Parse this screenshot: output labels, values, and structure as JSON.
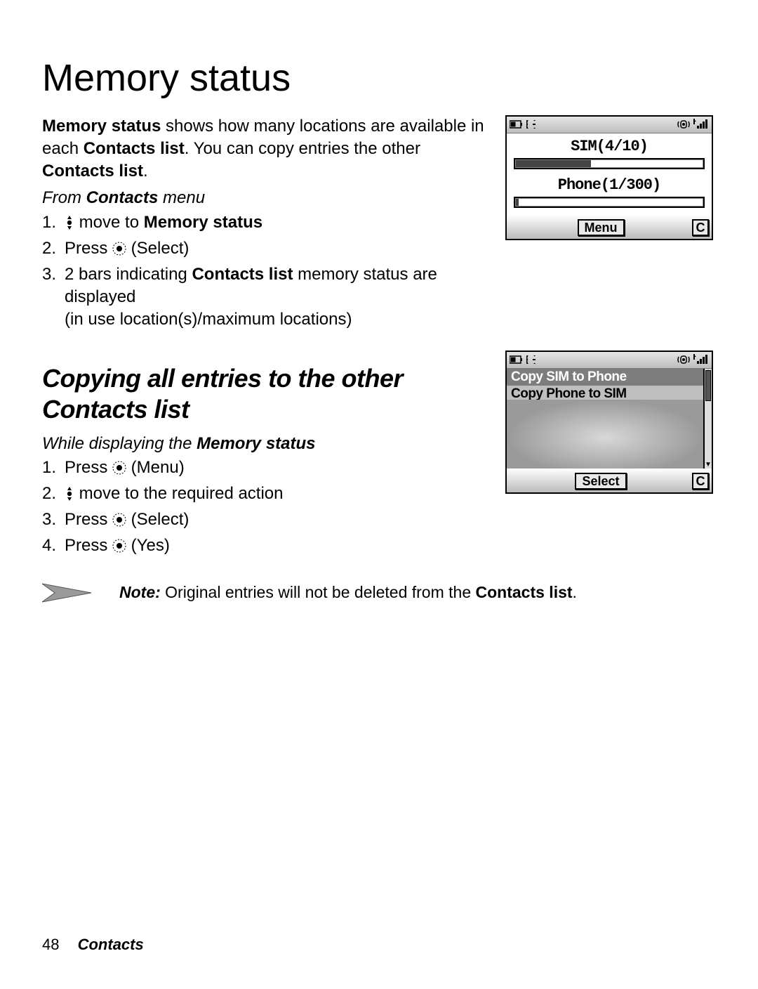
{
  "title": "Memory status",
  "intro": {
    "lead_bold": "Memory status",
    "lead_rest": " shows how many locations are available in each ",
    "lead_bold2": "Contacts list",
    "lead_rest2": ". You can copy entries the other ",
    "lead_bold3": "Contacts list",
    "lead_rest3": "."
  },
  "sub1": {
    "prefix": "From ",
    "bold": "Contacts",
    "suffix": " menu"
  },
  "steps1": {
    "s1a": " move to ",
    "s1b": "Memory status",
    "s2a": "Press ",
    "s2b": " (Select)",
    "s3a": "2 bars indicating ",
    "s3b": "Contacts list",
    "s3c": " memory status are displayed",
    "s3d": "(in use location(s)/maximum locations)"
  },
  "section2_title": "Copying all entries to the other Contacts list",
  "sub2": {
    "prefix": "While displaying the ",
    "bold": "Memory status"
  },
  "steps2": {
    "s1a": "Press ",
    "s1b": " (Menu)",
    "s2": " move to the required action",
    "s3a": "Press ",
    "s3b": " (Select)",
    "s4a": "Press ",
    "s4b": " (Yes)"
  },
  "note": {
    "lead": "Note:",
    "body": " Original entries will not be deleted from the ",
    "bold": "Contacts list",
    "tail": "."
  },
  "footer": {
    "page": "48",
    "section": "Contacts"
  },
  "phone1": {
    "sim_label": "SIM(4/10)",
    "phone_label": "Phone(1/300)",
    "soft_center": "Menu",
    "soft_right": "C"
  },
  "phone2": {
    "item1": "Copy SIM to Phone",
    "item2": "Copy Phone to SIM",
    "soft_center": "Select",
    "soft_right": "C"
  },
  "chart_data": [
    {
      "type": "bar",
      "title": "SIM memory status",
      "categories": [
        "SIM"
      ],
      "values": [
        4
      ],
      "max": 10,
      "ylim": [
        0,
        10
      ]
    },
    {
      "type": "bar",
      "title": "Phone memory status",
      "categories": [
        "Phone"
      ],
      "values": [
        1
      ],
      "max": 300,
      "ylim": [
        0,
        300
      ]
    }
  ]
}
